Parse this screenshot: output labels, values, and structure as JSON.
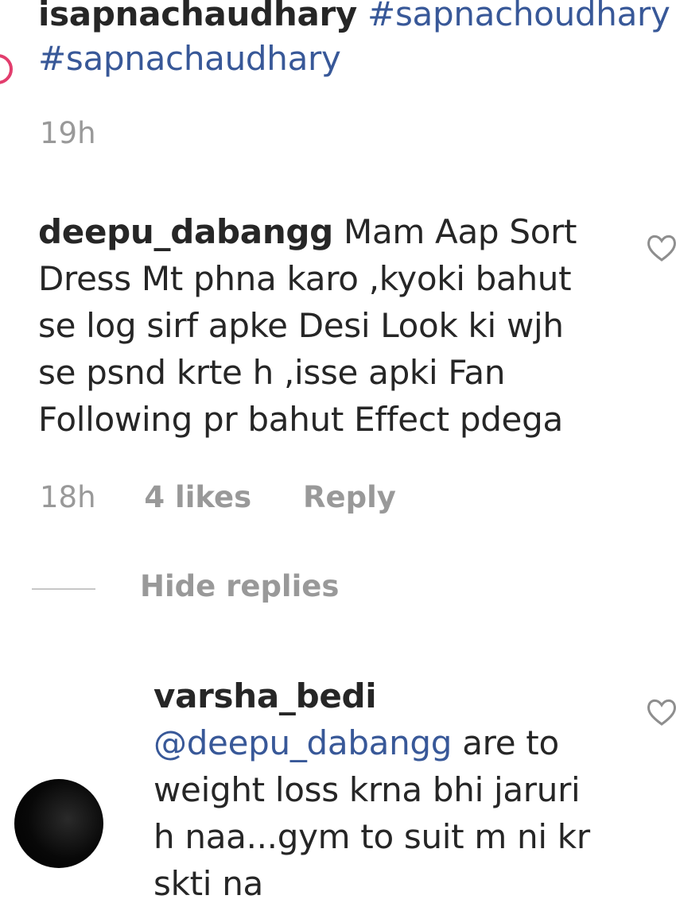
{
  "caption": {
    "user": "isapnachaudhary",
    "line1_tag": "#sapnachoudhary",
    "line2_tag": "#sapnachaudhary",
    "time": "19h"
  },
  "comment": {
    "user": "deepu_dabangg",
    "lines": [
      "Mam Aap Sort",
      "Dress Mt phna karo ,kyoki bahut",
      "se log sirf apke Desi Look ki wjh",
      "se psnd krte h ,isse apki Fan",
      "Following pr bahut Effect pdega"
    ],
    "time": "18h",
    "likes": "4 likes",
    "reply": "Reply",
    "like_icon": "heart-outline-icon"
  },
  "replies_toggle": {
    "label": "Hide replies"
  },
  "reply_comment": {
    "user": "varsha_bedi",
    "mention": "@deepu_dabangg",
    "lines": [
      "are to",
      "weight loss krna bhi jaruri",
      "h naa...gym to suit m ni kr",
      "skti na"
    ],
    "like_icon": "heart-outline-icon"
  },
  "colors": {
    "link": "#385898",
    "meta": "#999999",
    "text": "#262626",
    "story_ring": "#e23d6d"
  }
}
